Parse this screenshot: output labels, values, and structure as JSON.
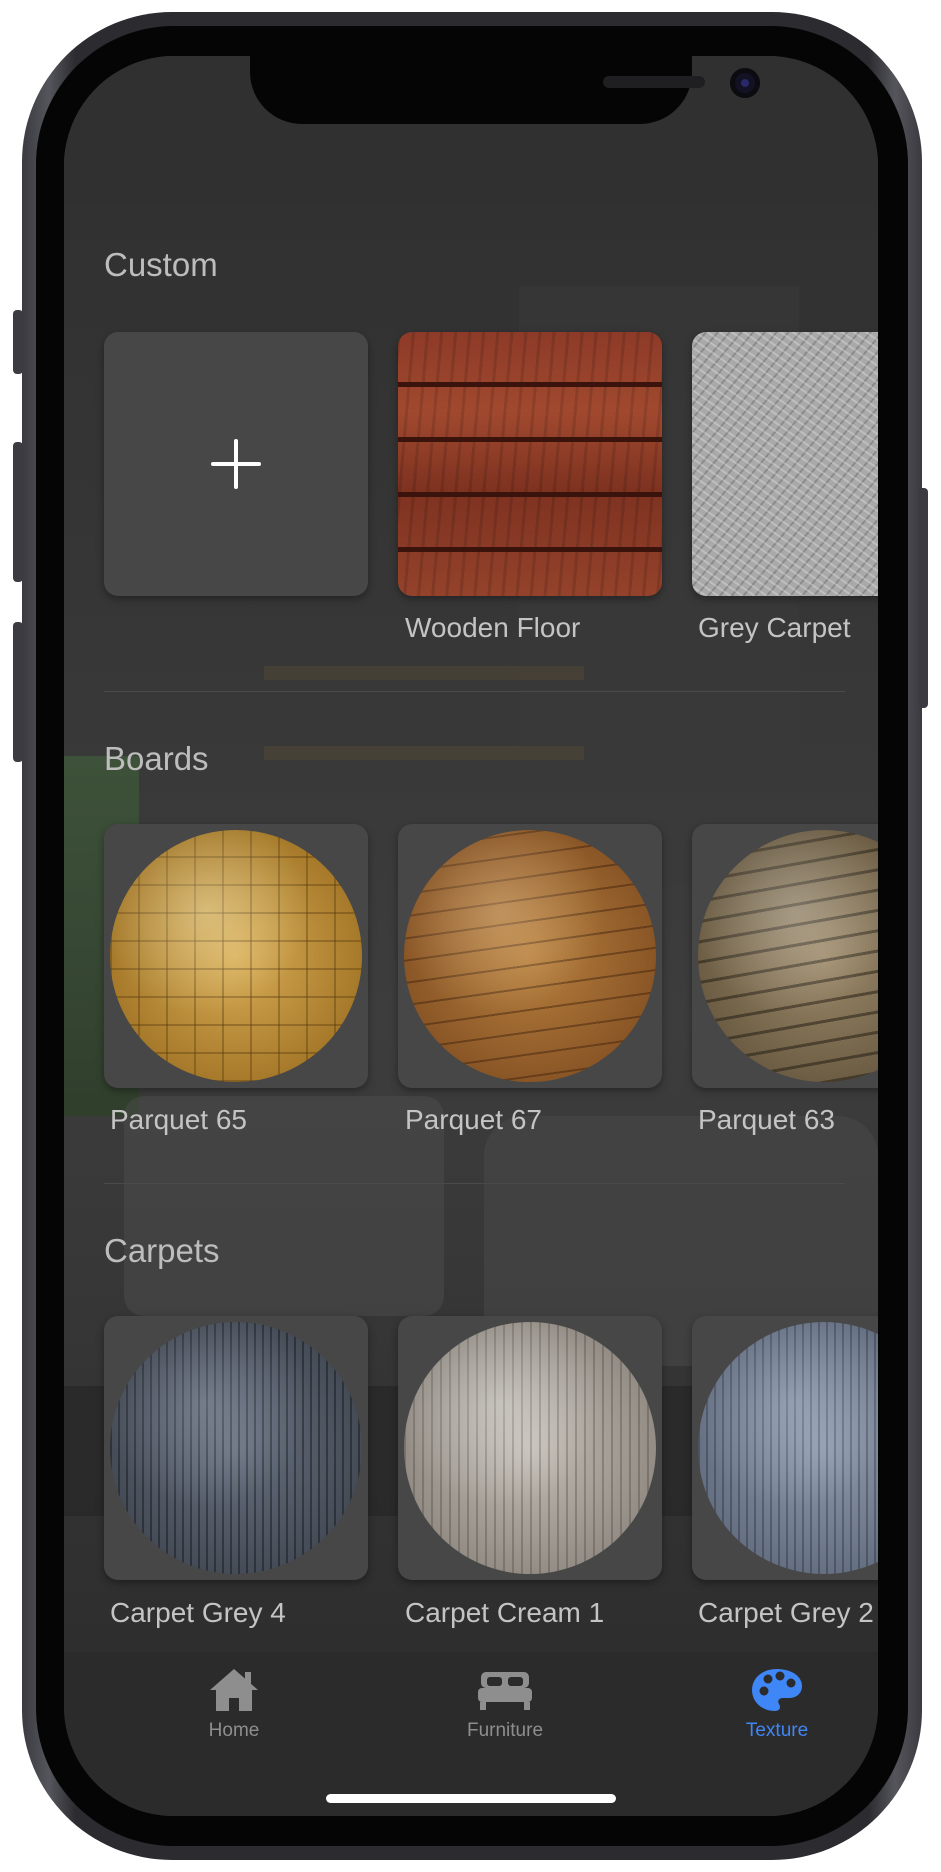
{
  "sections": [
    {
      "title": "Custom",
      "items": [
        {
          "label": "",
          "icon": "plus-icon"
        },
        {
          "label": "Wooden Floor"
        },
        {
          "label": "Grey Carpet"
        }
      ]
    },
    {
      "title": "Boards",
      "items": [
        {
          "label": "Parquet 65"
        },
        {
          "label": "Parquet 67"
        },
        {
          "label": "Parquet 63"
        }
      ]
    },
    {
      "title": "Carpets",
      "items": [
        {
          "label": "Carpet Grey 4"
        },
        {
          "label": "Carpet Cream 1"
        },
        {
          "label": "Carpet Grey 2"
        }
      ]
    }
  ],
  "tabbar": {
    "tabs": [
      {
        "label": "Home",
        "icon": "house-icon",
        "selected": false
      },
      {
        "label": "Furniture",
        "icon": "bed-icon",
        "selected": false
      },
      {
        "label": "Texture",
        "icon": "palette-icon",
        "selected": true
      }
    ],
    "active_color": "#3f86f7",
    "inactive_color": "#8e8e8e"
  }
}
